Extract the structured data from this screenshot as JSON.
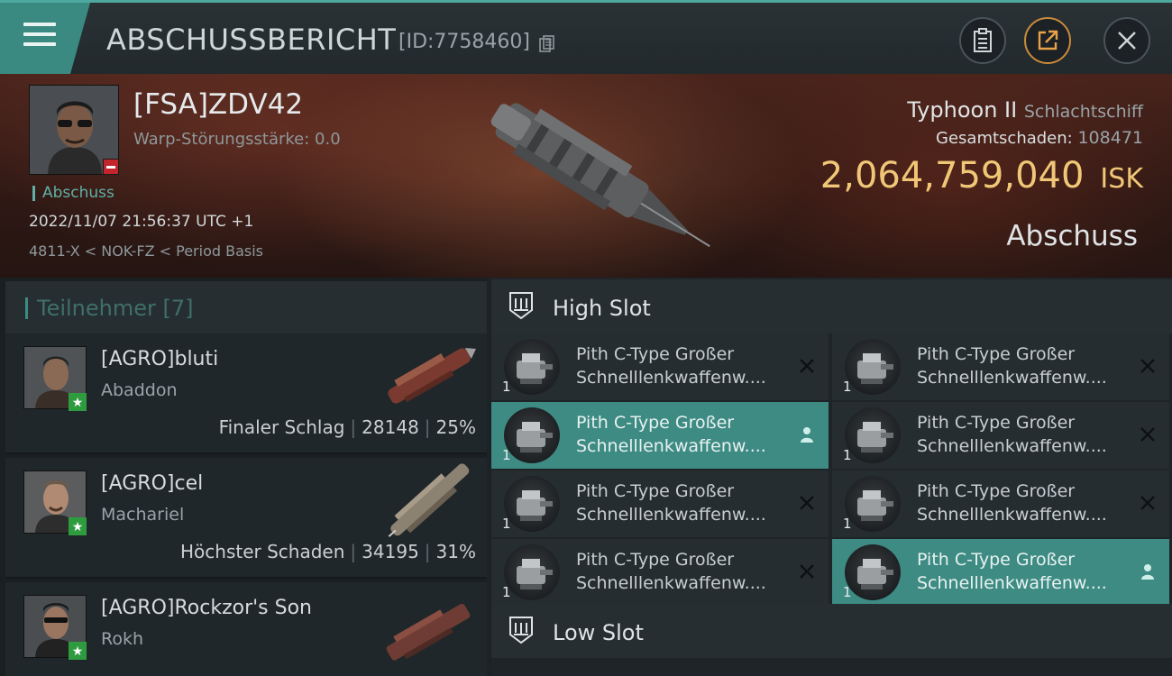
{
  "header": {
    "title": "ABSCHUSSBERICHT",
    "report_id": "[ID:7758460]",
    "icons": [
      "menu-icon",
      "copy-icon",
      "clipboard-icon",
      "share-icon",
      "close-icon"
    ]
  },
  "victim": {
    "name": "[FSA]ZDV42",
    "warp_disruption": "Warp-Störungsstärke: 0.0",
    "kill_type_label": "Abschuss",
    "datetime": "2022/11/07 21:56:37 UTC +1",
    "location": "4811-X < NOK-FZ < Period Basis",
    "ship_name": "Typhoon II",
    "ship_class": "Schlachtschiff",
    "total_damage_label": "Gesamtschaden:",
    "total_damage": "108471",
    "isk_value": "2,064,759,040",
    "isk_unit": "ISK",
    "result_label": "Abschuss"
  },
  "participants": {
    "label": "Teilnehmer",
    "count": "[7]",
    "items": [
      {
        "name": "[AGRO]bluti",
        "ship": "Abaddon",
        "role": "Finaler Schlag",
        "damage": "28148",
        "percent": "25%"
      },
      {
        "name": "[AGRO]cel",
        "ship": "Machariel",
        "role": "Höchster Schaden",
        "damage": "34195",
        "percent": "31%"
      },
      {
        "name": "[AGRO]Rockzor's Son",
        "ship": "Rokh",
        "role": "",
        "damage": "",
        "percent": ""
      }
    ]
  },
  "slots": {
    "high_slot_label": "High Slot",
    "low_slot_label": "Low Slot",
    "high_modules": [
      {
        "line1": "Pith C-Type Großer",
        "line2": "Schnelllenkwaffenw....",
        "qty": "1",
        "status": "destroyed"
      },
      {
        "line1": "Pith C-Type Großer",
        "line2": "Schnelllenkwaffenw....",
        "qty": "1",
        "status": "destroyed"
      },
      {
        "line1": "Pith C-Type Großer",
        "line2": "Schnelllenkwaffenw....",
        "qty": "1",
        "status": "dropped"
      },
      {
        "line1": "Pith C-Type Großer",
        "line2": "Schnelllenkwaffenw....",
        "qty": "1",
        "status": "destroyed"
      },
      {
        "line1": "Pith C-Type Großer",
        "line2": "Schnelllenkwaffenw....",
        "qty": "1",
        "status": "destroyed"
      },
      {
        "line1": "Pith C-Type Großer",
        "line2": "Schnelllenkwaffenw....",
        "qty": "1",
        "status": "destroyed"
      },
      {
        "line1": "Pith C-Type Großer",
        "line2": "Schnelllenkwaffenw....",
        "qty": "1",
        "status": "destroyed"
      },
      {
        "line1": "Pith C-Type Großer",
        "line2": "Schnelllenkwaffenw....",
        "qty": "1",
        "status": "dropped"
      }
    ]
  },
  "colors": {
    "accent": "#3e8b84",
    "isk": "#f1c777",
    "minus_badge": "#c4242b",
    "star_badge": "#2f9b3f"
  }
}
